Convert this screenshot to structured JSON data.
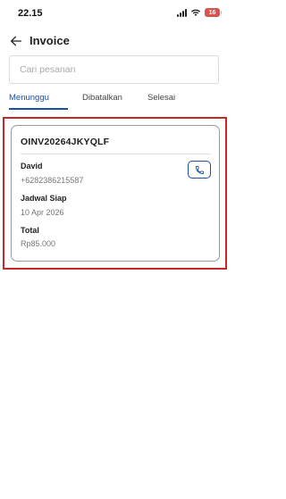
{
  "status_bar": {
    "time": "22.15",
    "battery_level": "16",
    "battery_color": "#d9534f"
  },
  "header": {
    "title": "Invoice",
    "back_icon": "arrow-left-icon"
  },
  "search": {
    "placeholder": "Cari pesanan",
    "value": ""
  },
  "tabs": [
    {
      "label": "Menunggu",
      "active": true
    },
    {
      "label": "Dibatalkan",
      "active": false
    },
    {
      "label": "Selesai",
      "active": false
    }
  ],
  "accent_color": "#1a4fa3",
  "invoice": {
    "number": "OINV20264JKYQLF",
    "customer_name": "David",
    "customer_phone": "+6282386215587",
    "schedule_label": "Jadwal Siap",
    "schedule_date": "10 Apr 2026",
    "total_label": "Total",
    "total_value": "Rp85.000",
    "call_icon": "phone-icon"
  }
}
